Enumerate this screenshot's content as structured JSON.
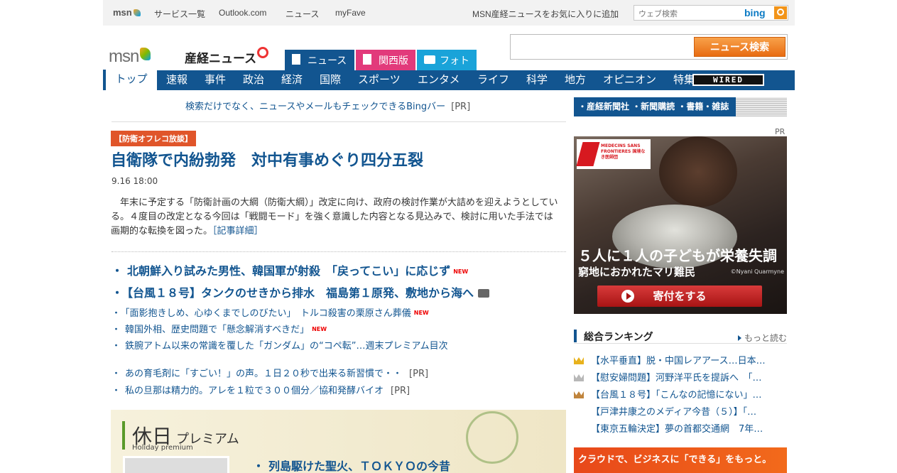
{
  "topbar": {
    "logo": "msn",
    "links": [
      "サービス一覧",
      "Outlook.com",
      "ニュース",
      "myFave"
    ],
    "favorite_link": "MSN産経ニュースをお気に入りに追加",
    "search_placeholder": "ウェブ検索",
    "search_brand": "bing"
  },
  "brand": {
    "msn": "msn",
    "sankei": "産経ニュース"
  },
  "service_tabs": [
    "ニュース",
    "関西版",
    "フォト"
  ],
  "news_search": {
    "value": "",
    "button": "ニュース検索"
  },
  "nav": {
    "items": [
      "トップ",
      "速報",
      "事件",
      "政治",
      "経済",
      "国際",
      "スポーツ",
      "エンタメ",
      "ライフ",
      "科学",
      "地方",
      "オピニオン",
      "特集"
    ],
    "wired": "WIRED"
  },
  "main": {
    "bing_pr": "検索だけでなく、ニュースやメールもチェックできるBingバー",
    "pr_label": "[PR]",
    "top_story": {
      "category": "【防衛オフレコ放談】",
      "headline": "自衛隊で内紛勃発　対中有事めぐり四分五裂",
      "date": "9.16 18:00",
      "lead": "年末に予定する「防衛計画の大綱（防衛大綱）」改定に向け、政府の検討作業が大詰めを迎えようとしている。４度目の改定となる今回は「戦闘モード」を強く意識した内容となる見込みで、検討に用いた手法では画期的な転換を図った。",
      "more": "［記事詳細］"
    },
    "big_items": [
      {
        "text": "北朝鮮入り試みた男性、韓国軍が射殺　「戻ってこい」に応じず",
        "badge": "NEW"
      },
      {
        "text": "【台風１８号】タンクのせきから排水　福島第１原発、敷地から海へ",
        "badge": ""
      }
    ],
    "small_items": [
      {
        "text": "「面影抱きしめ、心ゆくまでしのびたい」　トルコ殺害の栗原さん葬儀",
        "badge": "NEW"
      },
      {
        "text": "韓国外相、歴史問題で「懸念解消すべきだ」",
        "badge": "NEW"
      },
      {
        "text": "鉄腕アトム以来の常識を覆した「ガンダム」の“コペ転”…週末プレミアム目次",
        "badge": ""
      }
    ],
    "pr_items": [
      "あの育毛剤に「すごい！」の声。１日２０秒で出来る新習慣で・・",
      "私の旦那は精力的。アレを１粒で３００個分／協和発酵バイオ"
    ],
    "holiday": {
      "title": "休日",
      "title_small": "プレミアム",
      "subtitle": "Holiday premium",
      "item": "列島駆けた聖火、ＴＯＫＹＯの今昔"
    }
  },
  "sidebar": {
    "sankei_links": "・産経新聞社 ・新聞購読 ・書籍・雑誌",
    "ad_pr": "PR",
    "ad": {
      "org": "MEDECINS SANS FRONTIERES 国境なき医師団",
      "line1": "５人に１人の子どもが栄養失調",
      "line2": "窮地におかれたマリ難民",
      "credit": "©Nyani Quarmyne",
      "button": "寄付をする"
    },
    "ranking": {
      "title": "総合ランキング",
      "more": "もっと読む",
      "items": [
        "【水平垂直】脱・中国レアアース…日本…",
        "【慰安婦問題】河野洋平氏を提訴へ　「…",
        "【台風１８号】「こんなの記憶にない」…",
        "【戸津井康之のメディア今昔（５）】「…",
        "【東京五輪決定】夢の首都交通網　7年…"
      ],
      "crown_colors": [
        "#e8b21c",
        "#b8b8b8",
        "#c0843c",
        "#ffffff",
        "#ffffff"
      ]
    },
    "cloud_banner": "クラウドで、ビジネスに「できる」をもっと。"
  },
  "colors": {
    "brand_blue": "#125590",
    "accent_orange": "#e86c12",
    "kansai_pink": "#e23a7b",
    "photo_cyan": "#1aa3d9",
    "new_red": "#ee0000"
  }
}
